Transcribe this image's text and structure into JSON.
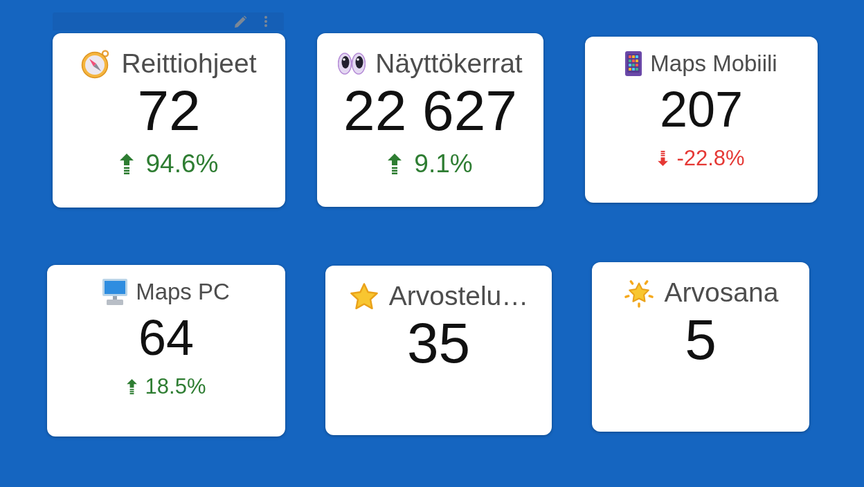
{
  "cards": [
    {
      "title": "Reittiohjeet",
      "value": "72",
      "trend": {
        "rising": true,
        "text": "94.6%"
      }
    },
    {
      "title": "Näyttökerrat",
      "value": "22 627",
      "trend": {
        "rising": true,
        "text": "9.1%"
      }
    },
    {
      "title": "Maps Mobiili",
      "value": "207",
      "trend": {
        "rising": false,
        "text": "-22.8%"
      }
    },
    {
      "title": "Maps PC",
      "value": "64",
      "trend": {
        "rising": true,
        "text": "18.5%"
      }
    },
    {
      "title": "Arvostelu…",
      "value": "35"
    },
    {
      "title": "Arvosana",
      "value": "5"
    }
  ]
}
